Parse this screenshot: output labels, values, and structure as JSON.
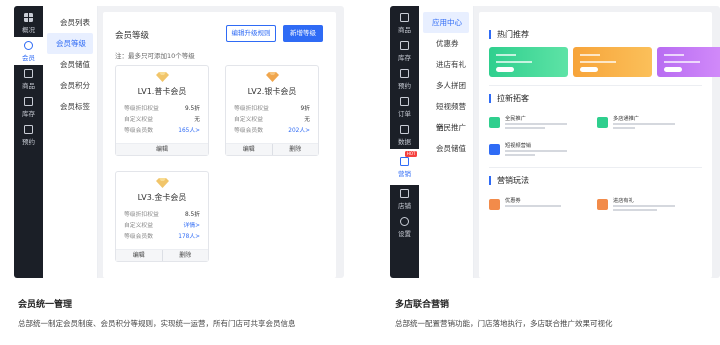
{
  "left_panel": {
    "rail": [
      {
        "label": "概况",
        "icon": "grid-icon"
      },
      {
        "label": "会员",
        "icon": "member-icon",
        "active": true
      },
      {
        "label": "商品",
        "icon": "goods-icon"
      },
      {
        "label": "库存",
        "icon": "inventory-icon"
      },
      {
        "label": "预约",
        "icon": "booking-icon"
      }
    ],
    "submenu": [
      {
        "label": "会员列表"
      },
      {
        "label": "会员等级",
        "active": true
      },
      {
        "label": "会员储值"
      },
      {
        "label": "会员积分"
      },
      {
        "label": "会员标签"
      }
    ],
    "main": {
      "title": "会员等级",
      "edit_rules_button": "编辑升级规则",
      "add_level_button": "新增等级",
      "note": "注：最多只可添加10个等级",
      "cards": [
        {
          "name": "LV1.普卡会员",
          "rows": [
            {
              "k": "等级折扣权益",
              "v": "9.5折"
            },
            {
              "k": "自定义权益",
              "v": "无"
            },
            {
              "k": "等级会员数",
              "v": "165人>"
            }
          ],
          "actions": [
            "编辑"
          ]
        },
        {
          "name": "LV2.银卡会员",
          "rows": [
            {
              "k": "等级折扣权益",
              "v": "9折"
            },
            {
              "k": "自定义权益",
              "v": "无"
            },
            {
              "k": "等级会员数",
              "v": "202人>"
            }
          ],
          "actions": [
            "编辑",
            "删除"
          ]
        },
        {
          "name": "LV3.金卡会员",
          "rows": [
            {
              "k": "等级折扣权益",
              "v": "8.5折"
            },
            {
              "k": "自定义权益",
              "v": "详情>"
            },
            {
              "k": "等级会员数",
              "v": "178人>"
            }
          ],
          "actions": [
            "编辑",
            "删除"
          ]
        }
      ]
    },
    "caption": {
      "title": "会员统一管理",
      "desc": "总部统一制定会员制度、会员积分等规则，实现统一运营，所有门店可共享会员信息"
    }
  },
  "right_panel": {
    "rail": [
      {
        "label": "商品",
        "icon": "goods-icon"
      },
      {
        "label": "库存",
        "icon": "inventory-icon"
      },
      {
        "label": "预约",
        "icon": "booking-icon"
      },
      {
        "label": "订单",
        "icon": "order-icon"
      },
      {
        "label": "数据",
        "icon": "data-icon"
      },
      {
        "label": "营销",
        "icon": "marketing-icon",
        "active": true,
        "tag": "HOT"
      },
      {
        "label": "店铺",
        "icon": "store-icon"
      },
      {
        "label": "设置",
        "icon": "settings-icon"
      }
    ],
    "submenu": [
      {
        "label": "应用中心",
        "active": true
      },
      {
        "label": "优惠券"
      },
      {
        "label": "进店有礼"
      },
      {
        "label": "多人拼团"
      },
      {
        "label": "短视频营销"
      },
      {
        "label": "全民推广"
      },
      {
        "label": "会员储值"
      }
    ],
    "main": {
      "sections": [
        {
          "title": "热门推荐"
        },
        {
          "title": "拉新拓客"
        },
        {
          "title": "营销玩法"
        }
      ],
      "features": [
        {
          "name": "全民推广",
          "color": "#2fcf8e"
        },
        {
          "name": "多店通推广",
          "color": "#2fcf8e"
        },
        {
          "name": "短视频营销",
          "color": "#2f6bf5"
        },
        {
          "name": "优惠券",
          "color": "#f28b4a"
        },
        {
          "name": "进店有礼",
          "color": "#f28b4a"
        }
      ],
      "colors": {
        "accent": "#2f6bf5"
      }
    },
    "caption": {
      "title": "多店联合营销",
      "desc": "总部统一配置营销功能，门店落地执行，多店联合推广效果可视化"
    }
  }
}
